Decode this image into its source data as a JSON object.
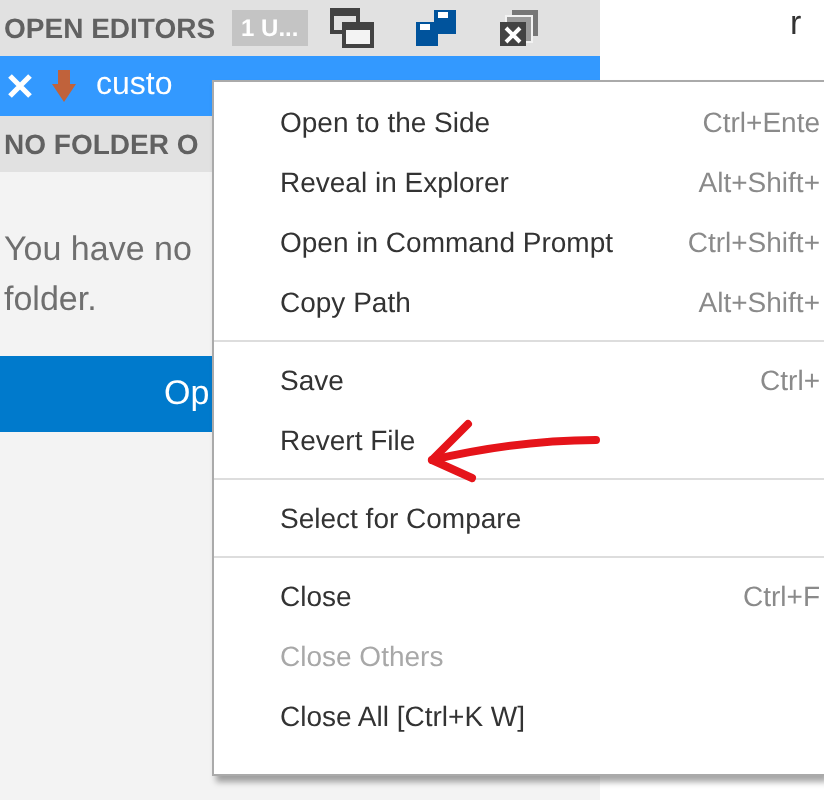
{
  "sidebar": {
    "open_editors": {
      "title": "OPEN EDITORS",
      "badge": "1 U...",
      "files": [
        {
          "name": "custo",
          "selected": true
        }
      ]
    },
    "no_folder": {
      "title": "NO FOLDER O",
      "message_lines": [
        "You have no",
        "folder."
      ],
      "button": "Op"
    }
  },
  "editor": {
    "lines": [
      "r"
    ]
  },
  "context_menu": {
    "groups": [
      [
        {
          "label": "Open to the Side",
          "shortcut": "Ctrl+Ente",
          "disabled": false
        },
        {
          "label": "Reveal in Explorer",
          "shortcut": "Alt+Shift+",
          "disabled": false
        },
        {
          "label": "Open in Command Prompt",
          "shortcut": "Ctrl+Shift+",
          "disabled": false
        },
        {
          "label": "Copy Path",
          "shortcut": "Alt+Shift+",
          "disabled": false
        }
      ],
      [
        {
          "label": "Save",
          "shortcut": "Ctrl+",
          "disabled": false
        },
        {
          "label": "Revert File",
          "disabled": false
        }
      ],
      [
        {
          "label": "Select for Compare",
          "disabled": false
        }
      ],
      [
        {
          "label": "Close",
          "shortcut": "Ctrl+F",
          "disabled": false
        },
        {
          "label": "Close Others",
          "disabled": true
        },
        {
          "label": "Close All [Ctrl+K W]",
          "disabled": false
        }
      ]
    ]
  },
  "annotation": {
    "kind": "arrow"
  }
}
